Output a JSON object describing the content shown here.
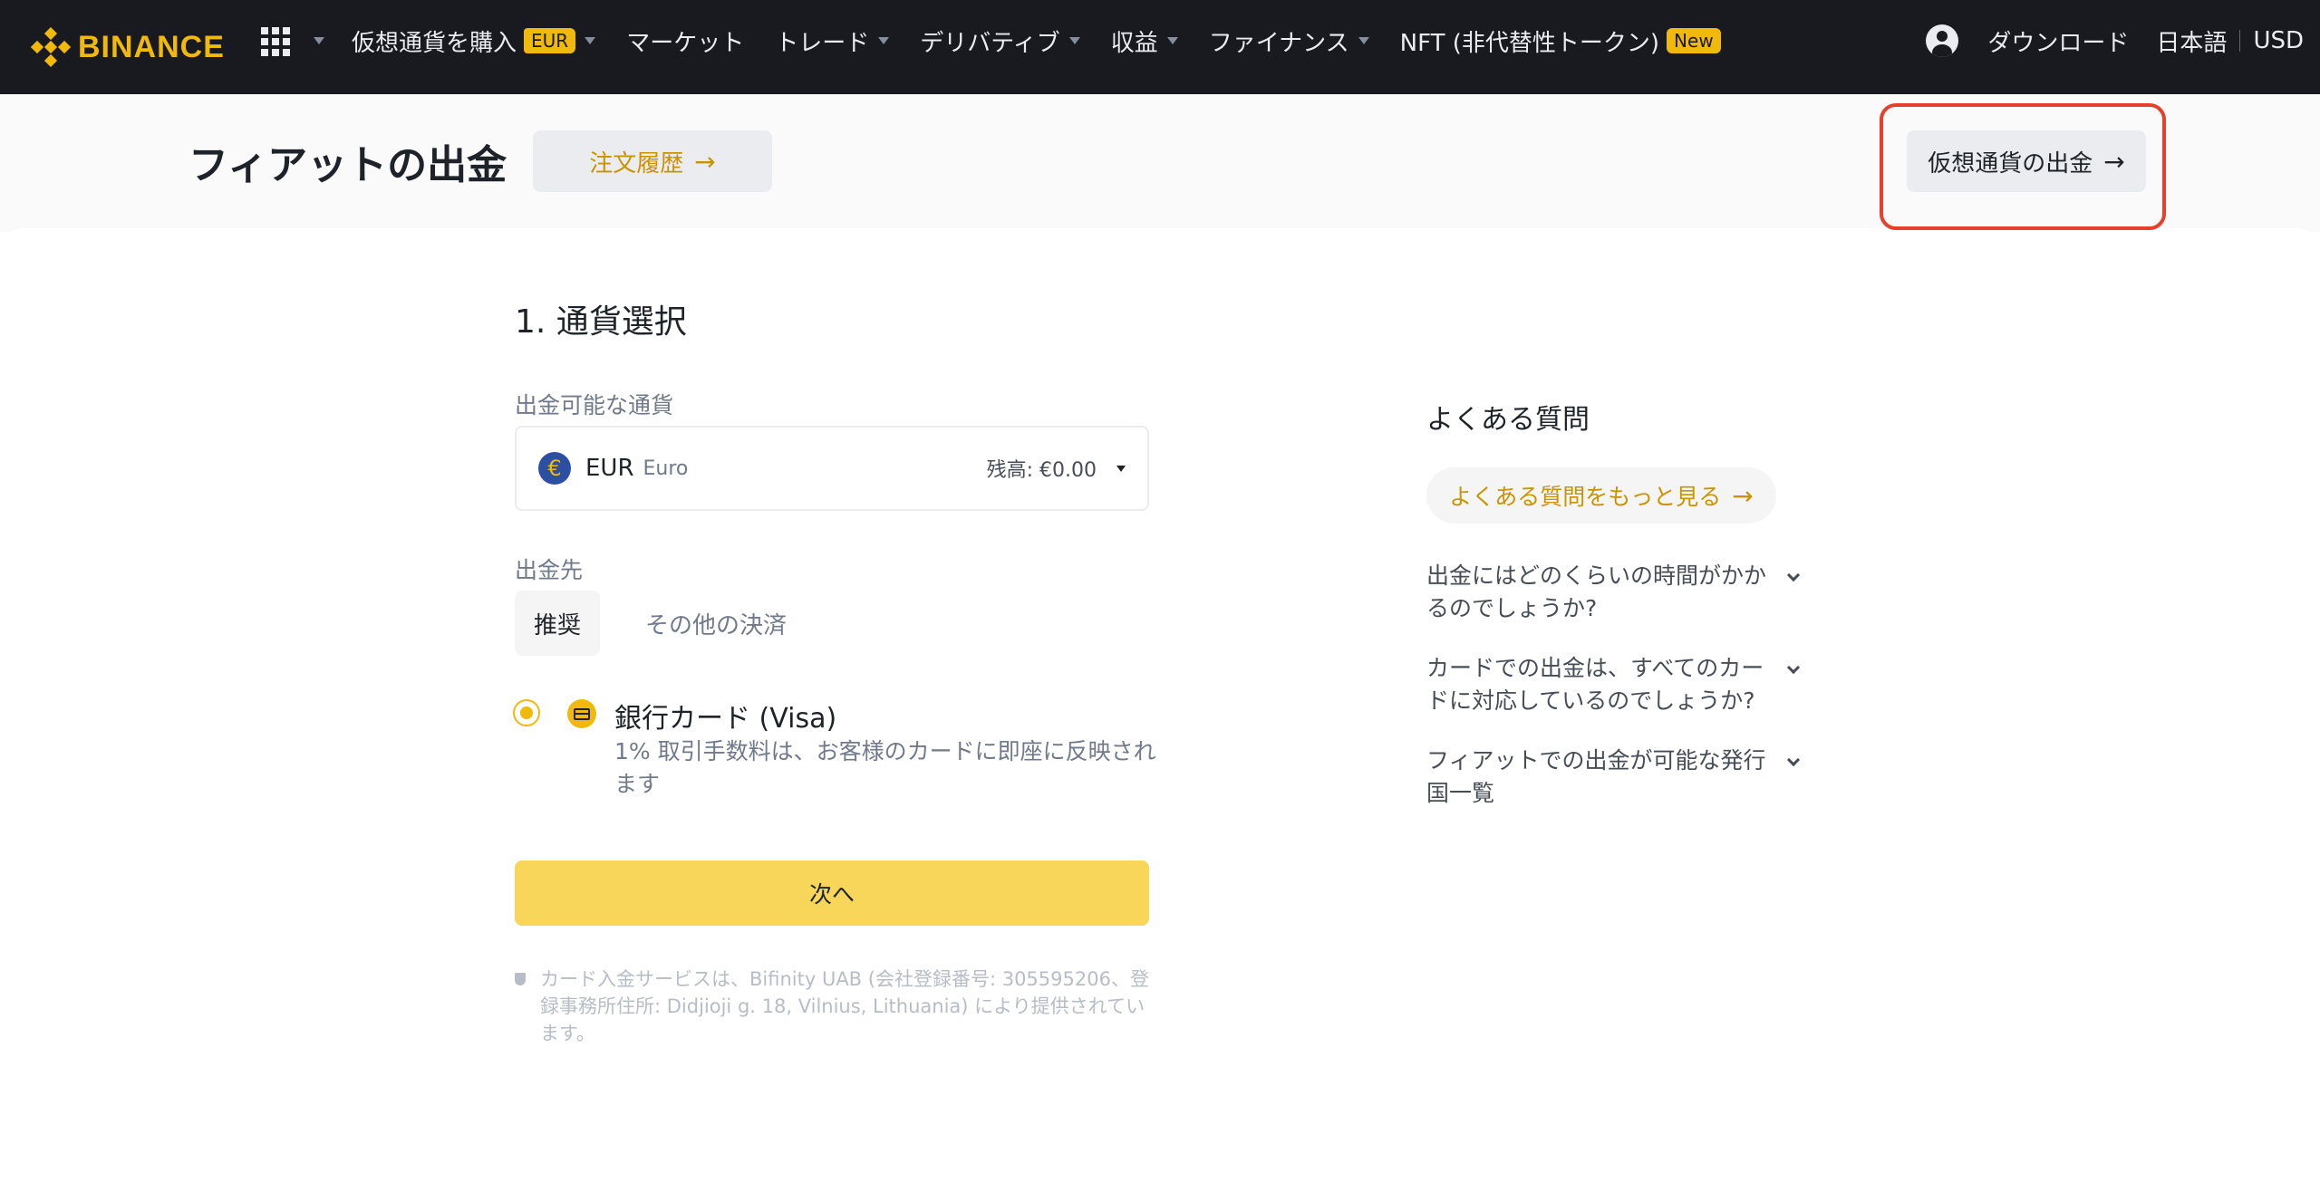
{
  "nav": {
    "brand": "BINANCE",
    "items": [
      {
        "label": "仮想通貨を購入",
        "badge": "EUR"
      },
      {
        "label": "マーケット"
      },
      {
        "label": "トレード"
      },
      {
        "label": "デリバティブ"
      },
      {
        "label": "収益"
      },
      {
        "label": "ファイナンス"
      },
      {
        "label": "NFT (非代替性トークン)",
        "badge": "New"
      }
    ],
    "download": "ダウンロード",
    "language": "日本語",
    "currency": "USD"
  },
  "header": {
    "title": "フィアットの出金",
    "history_button": "注文履歴",
    "crypto_withdraw_button": "仮想通貨の出金",
    "arrow": "→"
  },
  "form": {
    "step_title": "1. 通貨選択",
    "currency_label": "出金可能な通貨",
    "currency": {
      "symbol": "€",
      "code": "EUR",
      "name": "Euro",
      "balance": "残高: €0.00"
    },
    "destination_label": "出金先",
    "tabs": {
      "recommended": "推奨",
      "other": "その他の決済"
    },
    "method": {
      "title": "銀行カード (Visa)",
      "description": "1% 取引手数料は、お客様のカードに即座に反映されます",
      "selected": true
    },
    "next_button": "次へ",
    "disclaimer": "カード入金サービスは、Bifinity UAB (会社登録番号: 305595206、登録事務所住所: Didjioji g. 18, Vilnius, Lithuania) により提供されています。"
  },
  "faq": {
    "title": "よくある質問",
    "more_button": "よくある質問をもっと見る",
    "items": [
      "出金にはどのくらいの時間がかかるのでしょうか?",
      "カードでの出金は、すべてのカードに対応しているのでしょうか?",
      "フィアットでの出金が可能な発行国一覧"
    ]
  },
  "colors": {
    "brand": "#f0b90b",
    "nav_bg": "#181a20",
    "next_button": "#f7d659",
    "highlight": "#e4402b"
  }
}
